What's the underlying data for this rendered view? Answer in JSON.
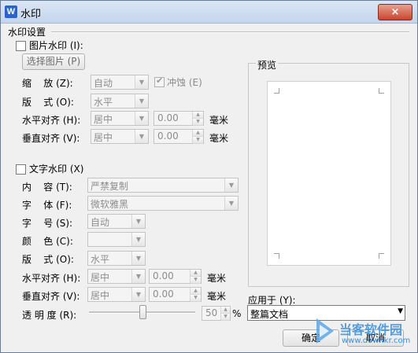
{
  "window": {
    "title": "水印",
    "app_icon_text": "W",
    "close_label": "×"
  },
  "group": {
    "title": "水印设置"
  },
  "picture": {
    "checkbox_label": "图片水印 (I):",
    "select_button": "选择图片 (P)",
    "scale_label": "缩    放 (Z):",
    "scale_value": "自动",
    "washout_label": "冲蚀 (E)",
    "washout_checked": true,
    "layout_label": "版    式 (O):",
    "layout_value": "水平",
    "halign_label": "水平对齐 (H):",
    "halign_value": "居中",
    "halign_offset": "0.00",
    "valign_label": "垂直对齐 (V):",
    "valign_value": "居中",
    "valign_offset": "0.00",
    "unit": "毫米"
  },
  "text": {
    "checkbox_label": "文字水印 (X)",
    "content_label": "内    容 (T):",
    "content_value": "严禁复制",
    "font_label": "字    体 (F):",
    "font_value": "微软雅黑",
    "size_label": "字    号 (S):",
    "size_value": "自动",
    "color_label": "颜    色 (C):",
    "layout_label": "版    式 (O):",
    "layout_value": "水平",
    "halign_label": "水平对齐 (H):",
    "halign_value": "居中",
    "halign_offset": "0.00",
    "valign_label": "垂直对齐 (V):",
    "valign_value": "居中",
    "valign_offset": "0.00",
    "unit": "毫米",
    "transparency_label": "透 明 度 (R):",
    "transparency_value": "50",
    "transparency_unit": "%",
    "transparency_level": 0.5
  },
  "preview": {
    "title": "预览"
  },
  "apply": {
    "label": "应用于 (Y):",
    "value": "整篇文档"
  },
  "buttons": {
    "ok": "确定",
    "cancel": "取消"
  },
  "overlay": {
    "site_cn": "当客软件园",
    "site_url": "www.downkr.com"
  }
}
